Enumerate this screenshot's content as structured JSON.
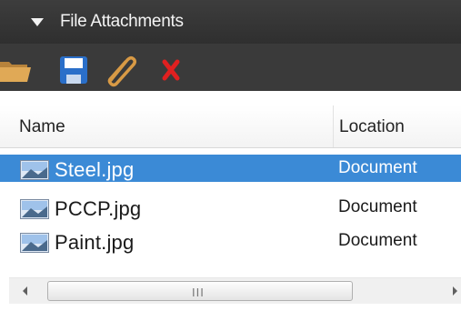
{
  "panel": {
    "title": "File Attachments",
    "toolbar": {
      "buttons": [
        {
          "name": "open-folder",
          "icon": "folder-icon"
        },
        {
          "name": "save",
          "icon": "floppy-disk-icon"
        },
        {
          "name": "attach",
          "icon": "paperclip-icon"
        },
        {
          "name": "delete",
          "icon": "red-x-icon"
        }
      ]
    },
    "columns": {
      "name": "Name",
      "location": "Location"
    },
    "files": [
      {
        "name": "Steel.jpg",
        "location": "Document",
        "selected": true,
        "icon": "image-file-icon"
      },
      {
        "name": "PCCP.jpg",
        "location": "Document",
        "selected": false,
        "icon": "image-file-icon"
      },
      {
        "name": "Paint.jpg",
        "location": "Document",
        "selected": false,
        "icon": "image-file-icon"
      }
    ],
    "scrollbar": {
      "grip": "III"
    }
  },
  "colors": {
    "header_bg": "#333333",
    "selection": "#3b8ad6",
    "delete": "#e02020",
    "save": "#2a6fc9"
  }
}
